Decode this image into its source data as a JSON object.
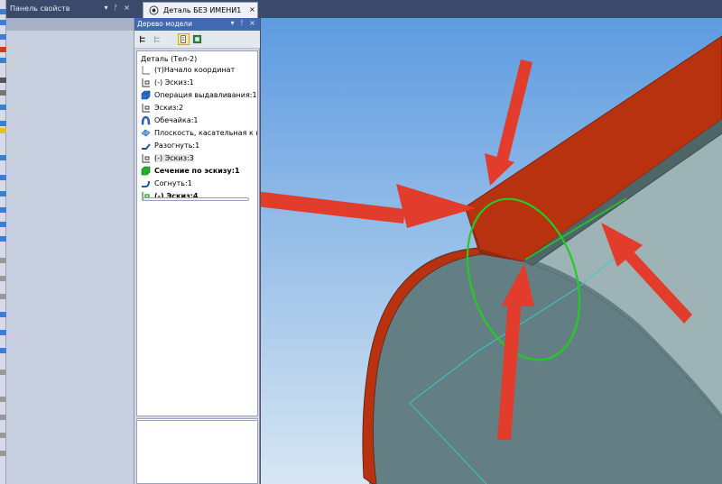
{
  "properties_panel": {
    "title": "Панель свойств",
    "dropdown_icon": "chevron-down-icon",
    "pin_icon": "pin-icon",
    "close_icon": "close-icon"
  },
  "document_tab": {
    "label": "Деталь БЕЗ ИМЕНИ1",
    "close": "×"
  },
  "model_tree": {
    "title": "Дерево модели",
    "root": "Деталь (Тел-2)",
    "items": [
      {
        "label": "(т)Начало координат",
        "icon": "origin-icon",
        "bold": false
      },
      {
        "label": "(-) Эскиз:1",
        "icon": "sketch-icon",
        "bold": false
      },
      {
        "label": "Операция выдавливания:1",
        "icon": "extrude-icon",
        "bold": false
      },
      {
        "label": "Эскиз:2",
        "icon": "sketch-icon",
        "bold": false
      },
      {
        "label": "Обечайка:1",
        "icon": "shell-icon",
        "bold": false
      },
      {
        "label": "Плоскость, касательная к пов",
        "icon": "plane-icon",
        "bold": false
      },
      {
        "label": "Разогнуть:1",
        "icon": "unbend-icon",
        "bold": false
      },
      {
        "label": "(-) Эскиз:3",
        "icon": "sketch-icon",
        "bold": false,
        "selected": true
      },
      {
        "label": "Сечение по эскизу:1",
        "icon": "section-icon",
        "bold": true
      },
      {
        "label": "Согнуть:1",
        "icon": "bend-icon",
        "bold": false
      },
      {
        "label": "(-) Эскиз:4",
        "icon": "sketch-icon",
        "bold": true
      }
    ]
  },
  "colors": {
    "flange_red": "#b83210",
    "body_gray": "#6f8a8e",
    "highlight_green": "#22cc22",
    "annotation_arrow": "#e23c2c",
    "sky_top": "#5d9be0",
    "sky_bottom": "#d7e6f2"
  }
}
